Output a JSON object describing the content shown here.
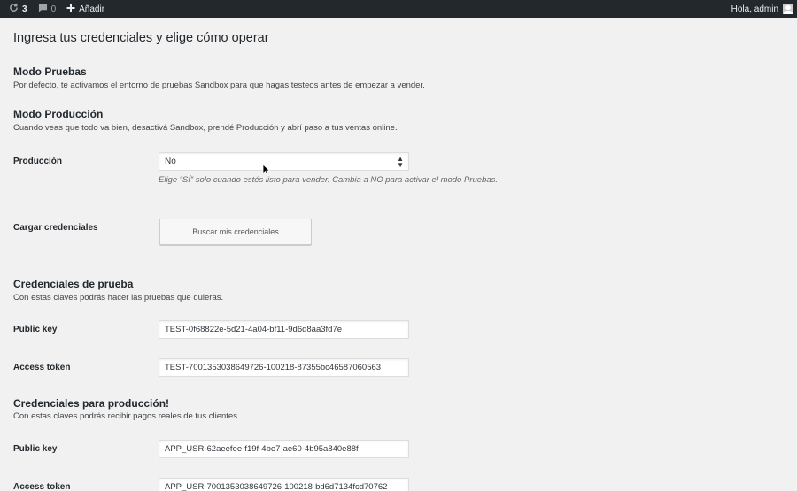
{
  "adminbar": {
    "updates_count": "3",
    "comments_count": "0",
    "new_label": "Añadir",
    "greeting": "Hola, admin"
  },
  "page": {
    "title": "Ingresa tus credenciales y elige cómo operar"
  },
  "sandbox": {
    "title": "Modo Pruebas",
    "description": "Por defecto, te activamos el entorno de pruebas Sandbox para que hagas testeos antes de empezar a vender."
  },
  "production_mode": {
    "title": "Modo Producción",
    "description": "Cuando veas que todo va bien, desactivá Sandbox, prendé Producción y abrí paso a tus ventas online."
  },
  "production_field": {
    "label": "Producción",
    "selected": "No",
    "help": "Elige “SÍ” solo cuando estés listo para vender. Cambia a NO para activar el modo Pruebas."
  },
  "credentials_load": {
    "label": "Cargar credenciales",
    "button": "Buscar mis credenciales"
  },
  "test_credentials": {
    "title": "Credenciales de prueba",
    "description": "Con estas claves podrás hacer las pruebas que quieras.",
    "public_key_label": "Public key",
    "public_key_value": "TEST-0f68822e-5d21-4a04-bf11-9d6d8aa3fd7e",
    "access_token_label": "Access token",
    "access_token_value": "TEST-7001353038649726-100218-87355bc46587060563"
  },
  "prod_credentials": {
    "title": "Credenciales para producción!",
    "description": "Con estas claves podrás recibir pagos reales de tus clientes.",
    "public_key_label": "Public key",
    "public_key_value": "APP_USR-62aeefee-f19f-4be7-ae60-4b95a840e88f",
    "access_token_label": "Access token",
    "access_token_value": "APP_USR-7001353038649726-100218-bd6d7134fcd70762"
  },
  "colors": {
    "adminbar_bg": "#23282d",
    "page_bg": "#f1f1f1"
  }
}
